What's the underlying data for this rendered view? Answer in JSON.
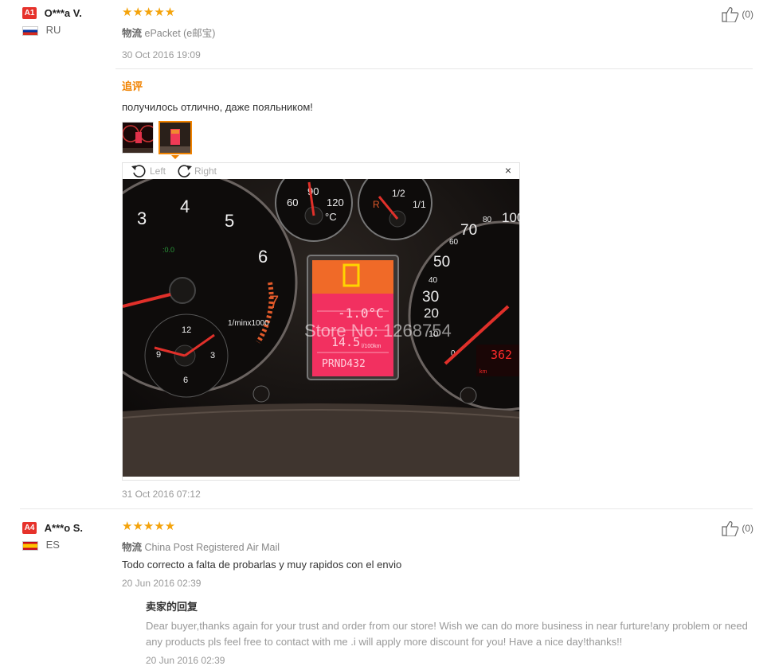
{
  "reviews": [
    {
      "badge": "A1",
      "user": "O***a V.",
      "country": "RU",
      "stars": "★★★★★",
      "logistics_label": "物流",
      "logistics": "ePacket (e邮宝)",
      "date": "30 Oct 2016 19:09",
      "likes": "(0)",
      "followup_title": "追评",
      "followup_text": "получилось отлично, даже пояльником!",
      "viewer": {
        "rotate_left": "Left",
        "rotate_right": "Right",
        "close": "×"
      },
      "photo": {
        "watermark": "Store No: 1268754",
        "tach": [
          "3",
          "4",
          "5",
          "6",
          "7"
        ],
        "tach_unit": "1/minx1000",
        "temp": [
          "60",
          "90",
          "120"
        ],
        "temp_unit": "°C",
        "fuel": [
          "1/2",
          "1/1"
        ],
        "fuel_r": "R",
        "clock": [
          "12",
          "3",
          "6",
          "9"
        ],
        "speed": [
          "0",
          "10",
          "20",
          "30",
          "40",
          "50",
          "60",
          "70",
          "80",
          "100"
        ],
        "lcd_line1": "-1.0°C",
        "lcd_line2": "14.5",
        "lcd_unit": "l/100km",
        "lcd_gear": "PRND432",
        "odo": "362",
        "odo_unit": "km",
        "green": ":0.0"
      },
      "followup_date": "31 Oct 2016 07:12"
    },
    {
      "badge": "A4",
      "user": "A***o S.",
      "country": "ES",
      "stars": "★★★★★",
      "logistics_label": "物流",
      "logistics": "China Post Registered Air Mail",
      "text": "Todo correcto a falta de probarlas y muy rapidos con el envio",
      "date": "20 Jun 2016 02:39",
      "likes": "(0)",
      "seller_title": "卖家的回复",
      "seller_text": "Dear buyer,thanks again for your trust and order from our store! Wish we can do more business in near furture!any problem or need any products pls feel free to contact with me .i will apply more discount for you! Have a nice day!thanks!!",
      "seller_date": "20 Jun 2016 02:39"
    }
  ],
  "colors": {
    "accent": "#f08200",
    "badge": "#e6322b",
    "star": "#f4a30b"
  }
}
